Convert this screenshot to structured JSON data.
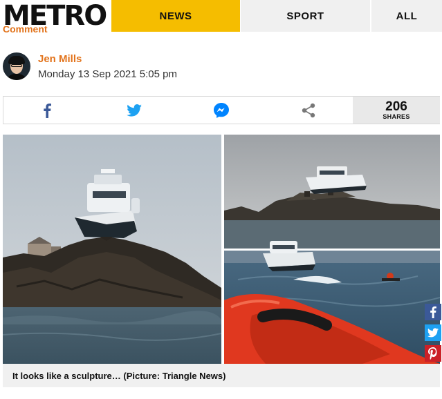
{
  "header": {
    "logo": "METRO",
    "nav": [
      "NEWS",
      "SPORT",
      "ALL"
    ]
  },
  "partial_label": "Comment",
  "author": {
    "name": "Jen Mills",
    "date": "Monday 13 Sep 2021 5:05 pm"
  },
  "share": {
    "count": "206",
    "count_label": "SHARES",
    "icons": [
      "facebook-icon",
      "twitter-icon",
      "messenger-icon",
      "share-icon"
    ]
  },
  "image": {
    "caption": "It looks like a sculpture… (Picture: Triangle News)"
  },
  "floating_share": [
    "facebook-icon",
    "twitter-icon",
    "pinterest-icon"
  ],
  "colors": {
    "brand_yellow": "#f5bd00",
    "author_orange": "#e2731b",
    "facebook": "#3b5998",
    "twitter": "#1da1f2",
    "messenger": "#0084ff",
    "pinterest": "#cb2027"
  }
}
